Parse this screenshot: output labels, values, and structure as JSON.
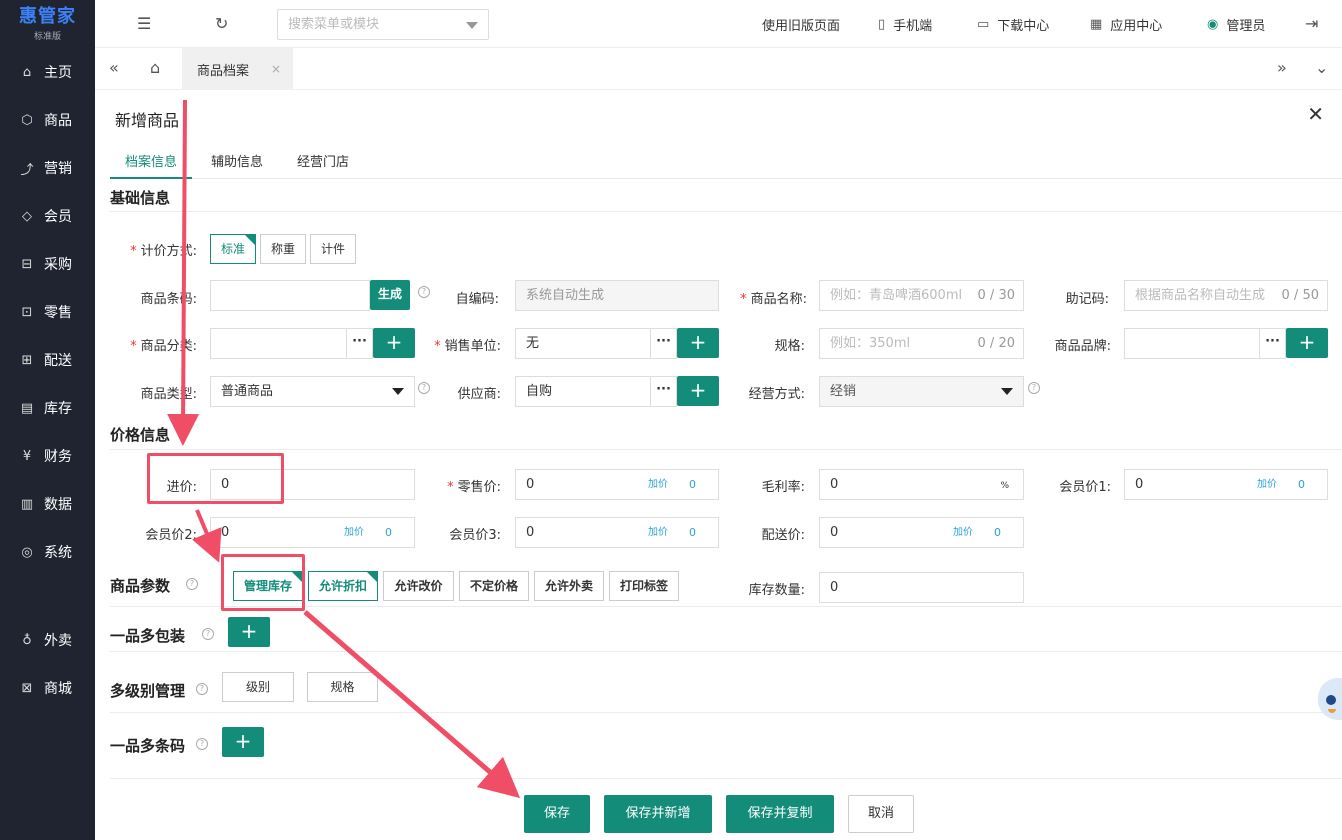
{
  "app": {
    "logo_title": "惠管家",
    "logo_subtitle": "标准版"
  },
  "sidebar": {
    "items": [
      {
        "label": "主页",
        "icon": "home-icon"
      },
      {
        "label": "商品",
        "icon": "box-icon"
      },
      {
        "label": "营销",
        "icon": "chart-icon"
      },
      {
        "label": "会员",
        "icon": "diamond-icon"
      },
      {
        "label": "采购",
        "icon": "cart-icon"
      },
      {
        "label": "零售",
        "icon": "bag-icon"
      },
      {
        "label": "配送",
        "icon": "truck-icon"
      },
      {
        "label": "库存",
        "icon": "warehouse-icon"
      },
      {
        "label": "财务",
        "icon": "yen-icon"
      },
      {
        "label": "数据",
        "icon": "bar-chart-icon"
      },
      {
        "label": "系统",
        "icon": "settings-icon"
      },
      {
        "label": "外卖",
        "icon": "bike-icon"
      },
      {
        "label": "商城",
        "icon": "shop-icon"
      }
    ]
  },
  "header": {
    "search_placeholder": "搜索菜单或模块",
    "old_version": "使用旧版页面",
    "mobile": "手机端",
    "download": "下载中心",
    "apps": "应用中心",
    "user": "管理员"
  },
  "tabs": {
    "current": "商品档案"
  },
  "form": {
    "title": "新增商品",
    "tabs": [
      "档案信息",
      "辅助信息",
      "经营门店"
    ],
    "basic": {
      "section_title": "基础信息",
      "pricing_mode_label": "计价方式:",
      "pricing_modes": [
        "标准",
        "称重",
        "计件"
      ],
      "barcode_label": "商品条码:",
      "generate_btn": "生成",
      "selfcode_label": "自编码:",
      "selfcode_placeholder": "系统自动生成",
      "name_label": "商品名称:",
      "name_placeholder": "例如：青岛啤酒600ml",
      "name_count": "0 / 30",
      "memo_label": "助记码:",
      "memo_placeholder": "根据商品名称自动生成",
      "memo_count": "0 / 50",
      "category_label": "商品分类:",
      "unit_label": "销售单位:",
      "unit_value": "无",
      "spec_label": "规格:",
      "spec_placeholder": "例如：350ml",
      "spec_count": "0 / 20",
      "brand_label": "商品品牌:",
      "type_label": "商品类型:",
      "type_value": "普通商品",
      "supplier_label": "供应商:",
      "supplier_value": "自购",
      "mode_label": "经营方式:",
      "mode_value": "经销"
    },
    "price": {
      "section_title": "价格信息",
      "purchase_label": "进价:",
      "purchase_value": "0",
      "retail_label": "零售价:",
      "retail_value": "0",
      "markup_label": "加价",
      "markup_value": "0",
      "margin_label": "毛利率:",
      "margin_value": "0",
      "percent": "%",
      "member1_label": "会员价1:",
      "member1_value": "0",
      "member2_label": "会员价2:",
      "member2_value": "0",
      "member3_label": "会员价3:",
      "member3_value": "0",
      "delivery_label": "配送价:",
      "delivery_value": "0"
    },
    "params": {
      "section_title": "商品参数",
      "options": [
        "管理库存",
        "允许折扣",
        "允许改价",
        "不定价格",
        "允许外卖",
        "打印标签"
      ],
      "stock_label": "库存数量:",
      "stock_value": "0"
    },
    "multi_pack": {
      "title": "一品多包装"
    },
    "multi_level": {
      "title": "多级别管理",
      "level_btn": "级别",
      "spec_btn": "规格"
    },
    "multi_barcode": {
      "title": "一品多条码"
    },
    "actions": {
      "save": "保存",
      "save_new": "保存并新增",
      "save_copy": "保存并复制",
      "cancel": "取消"
    }
  },
  "colors": {
    "accent": "#138c7a",
    "sidebar_bg": "#1f2430",
    "annotation": "#f04d66",
    "logo": "#3b82f6"
  }
}
